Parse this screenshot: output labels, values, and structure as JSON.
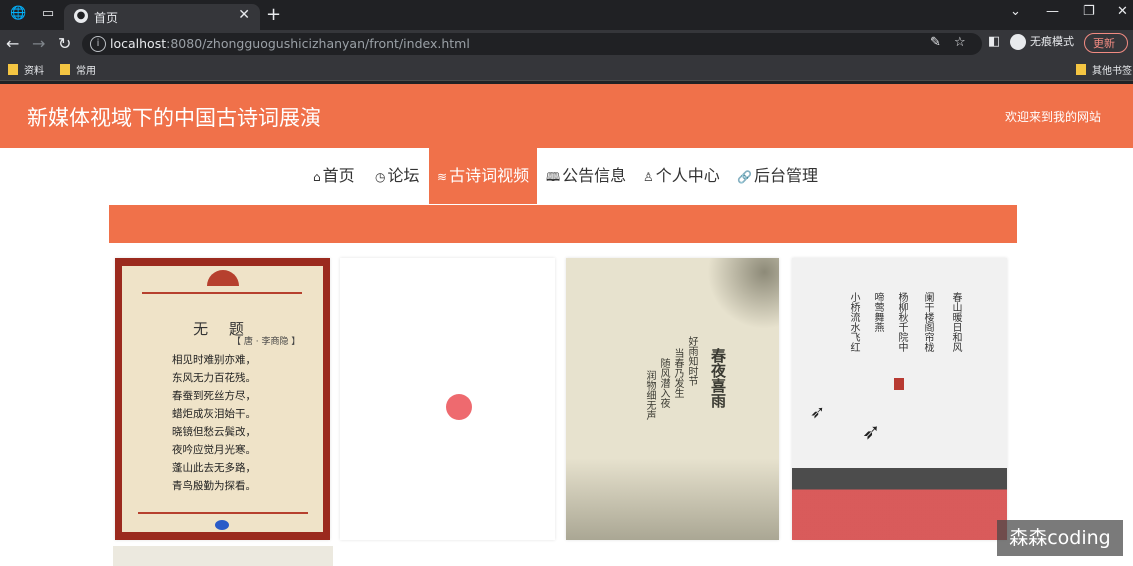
{
  "browser": {
    "tab_title": "首页",
    "url_host": "localhost",
    "url_rest": ":8080/zhongguogushicizhanyan/front/index.html",
    "incognito_label": "无痕模式",
    "update_label": "更新",
    "bookmarks": [
      "资料",
      "常用"
    ],
    "bookmarks_right": "其他书签"
  },
  "site": {
    "title": "新媒体视域下的中国古诗词展演",
    "welcome": "欢迎来到我的网站"
  },
  "nav": [
    {
      "label": "首页",
      "icon": "home-icon"
    },
    {
      "label": "论坛",
      "icon": "clock-icon"
    },
    {
      "label": "古诗词视频",
      "icon": "layers-icon"
    },
    {
      "label": "公告信息",
      "icon": "book-icon"
    },
    {
      "label": "个人中心",
      "icon": "user-icon"
    },
    {
      "label": "后台管理",
      "icon": "link-icon"
    }
  ],
  "nav_active_index": 2,
  "cards": {
    "poem1": {
      "title": "无 题",
      "subtitle": "【 唐 · 李商隐 】",
      "lines": [
        "相见时难别亦难，",
        "东风无力百花残。",
        "春蚕到死丝方尽，",
        "蜡炬成灰泪始干。",
        "晓镜但愁云鬓改，",
        "夜吟应觉月光寒。",
        "蓬山此去无多路，",
        "青鸟殷勤为探看。"
      ]
    },
    "poem3": {
      "title": "春夜喜雨",
      "cols": [
        "好雨知时节",
        "当春乃发生",
        "随风潜入夜",
        "润物细无声"
      ]
    },
    "poem4": {
      "cols": [
        "春山暖日和风",
        "阑干楼阁帘栊",
        "杨柳秋千院中",
        "啼莺舞燕",
        "小桥流水飞红"
      ]
    }
  },
  "watermark": "森森coding",
  "colors": {
    "accent": "#f0714a"
  }
}
